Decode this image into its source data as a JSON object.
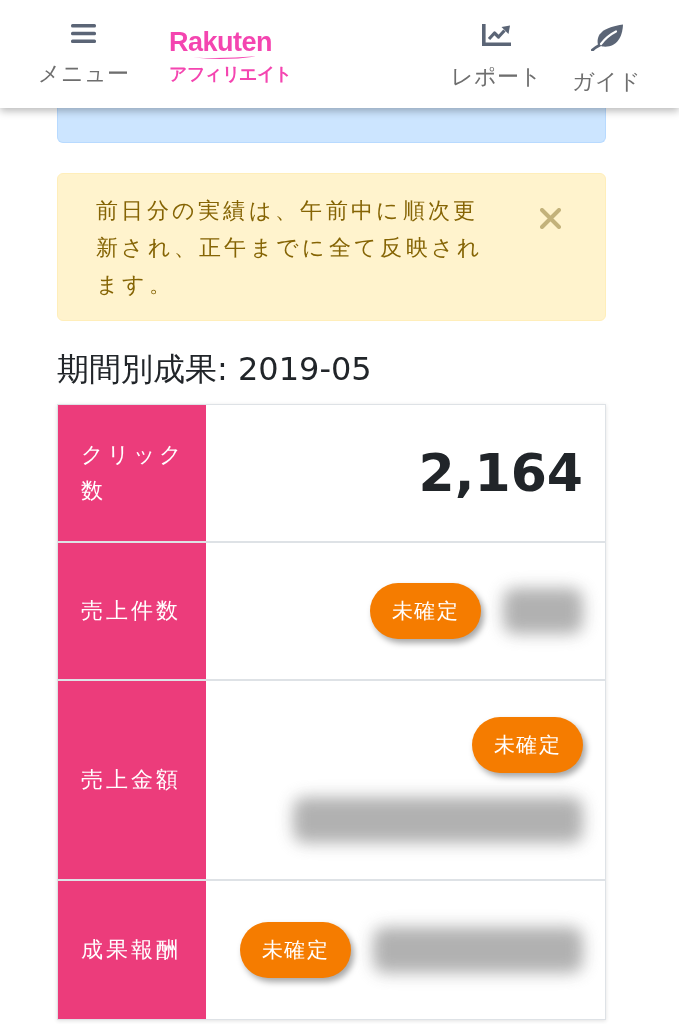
{
  "header": {
    "menu_label": "メニュー",
    "logo": {
      "brand": "Rakuten",
      "product": "アフィリエイト"
    },
    "nav": [
      {
        "kind": "chart",
        "label": "レポート"
      },
      {
        "kind": "leaf",
        "label": "ガイド"
      }
    ]
  },
  "alerts": [
    {
      "kind": "info"
    },
    {
      "kind": "warning",
      "text": "前日分の実績は、午前中に順次更新され、正午までに全て反映されます。",
      "dismissible": true
    }
  ],
  "heading": "期間別成果: 2019-05",
  "results": [
    {
      "label": "クリック数",
      "value": "2,164"
    },
    {
      "label": "売上件数",
      "badge": "未確定",
      "redacted": true
    },
    {
      "label": "売上金額",
      "badge": "未確定",
      "redacted": true
    },
    {
      "label": "成果報酬",
      "badge": "未確定",
      "redacted": true
    }
  ]
}
